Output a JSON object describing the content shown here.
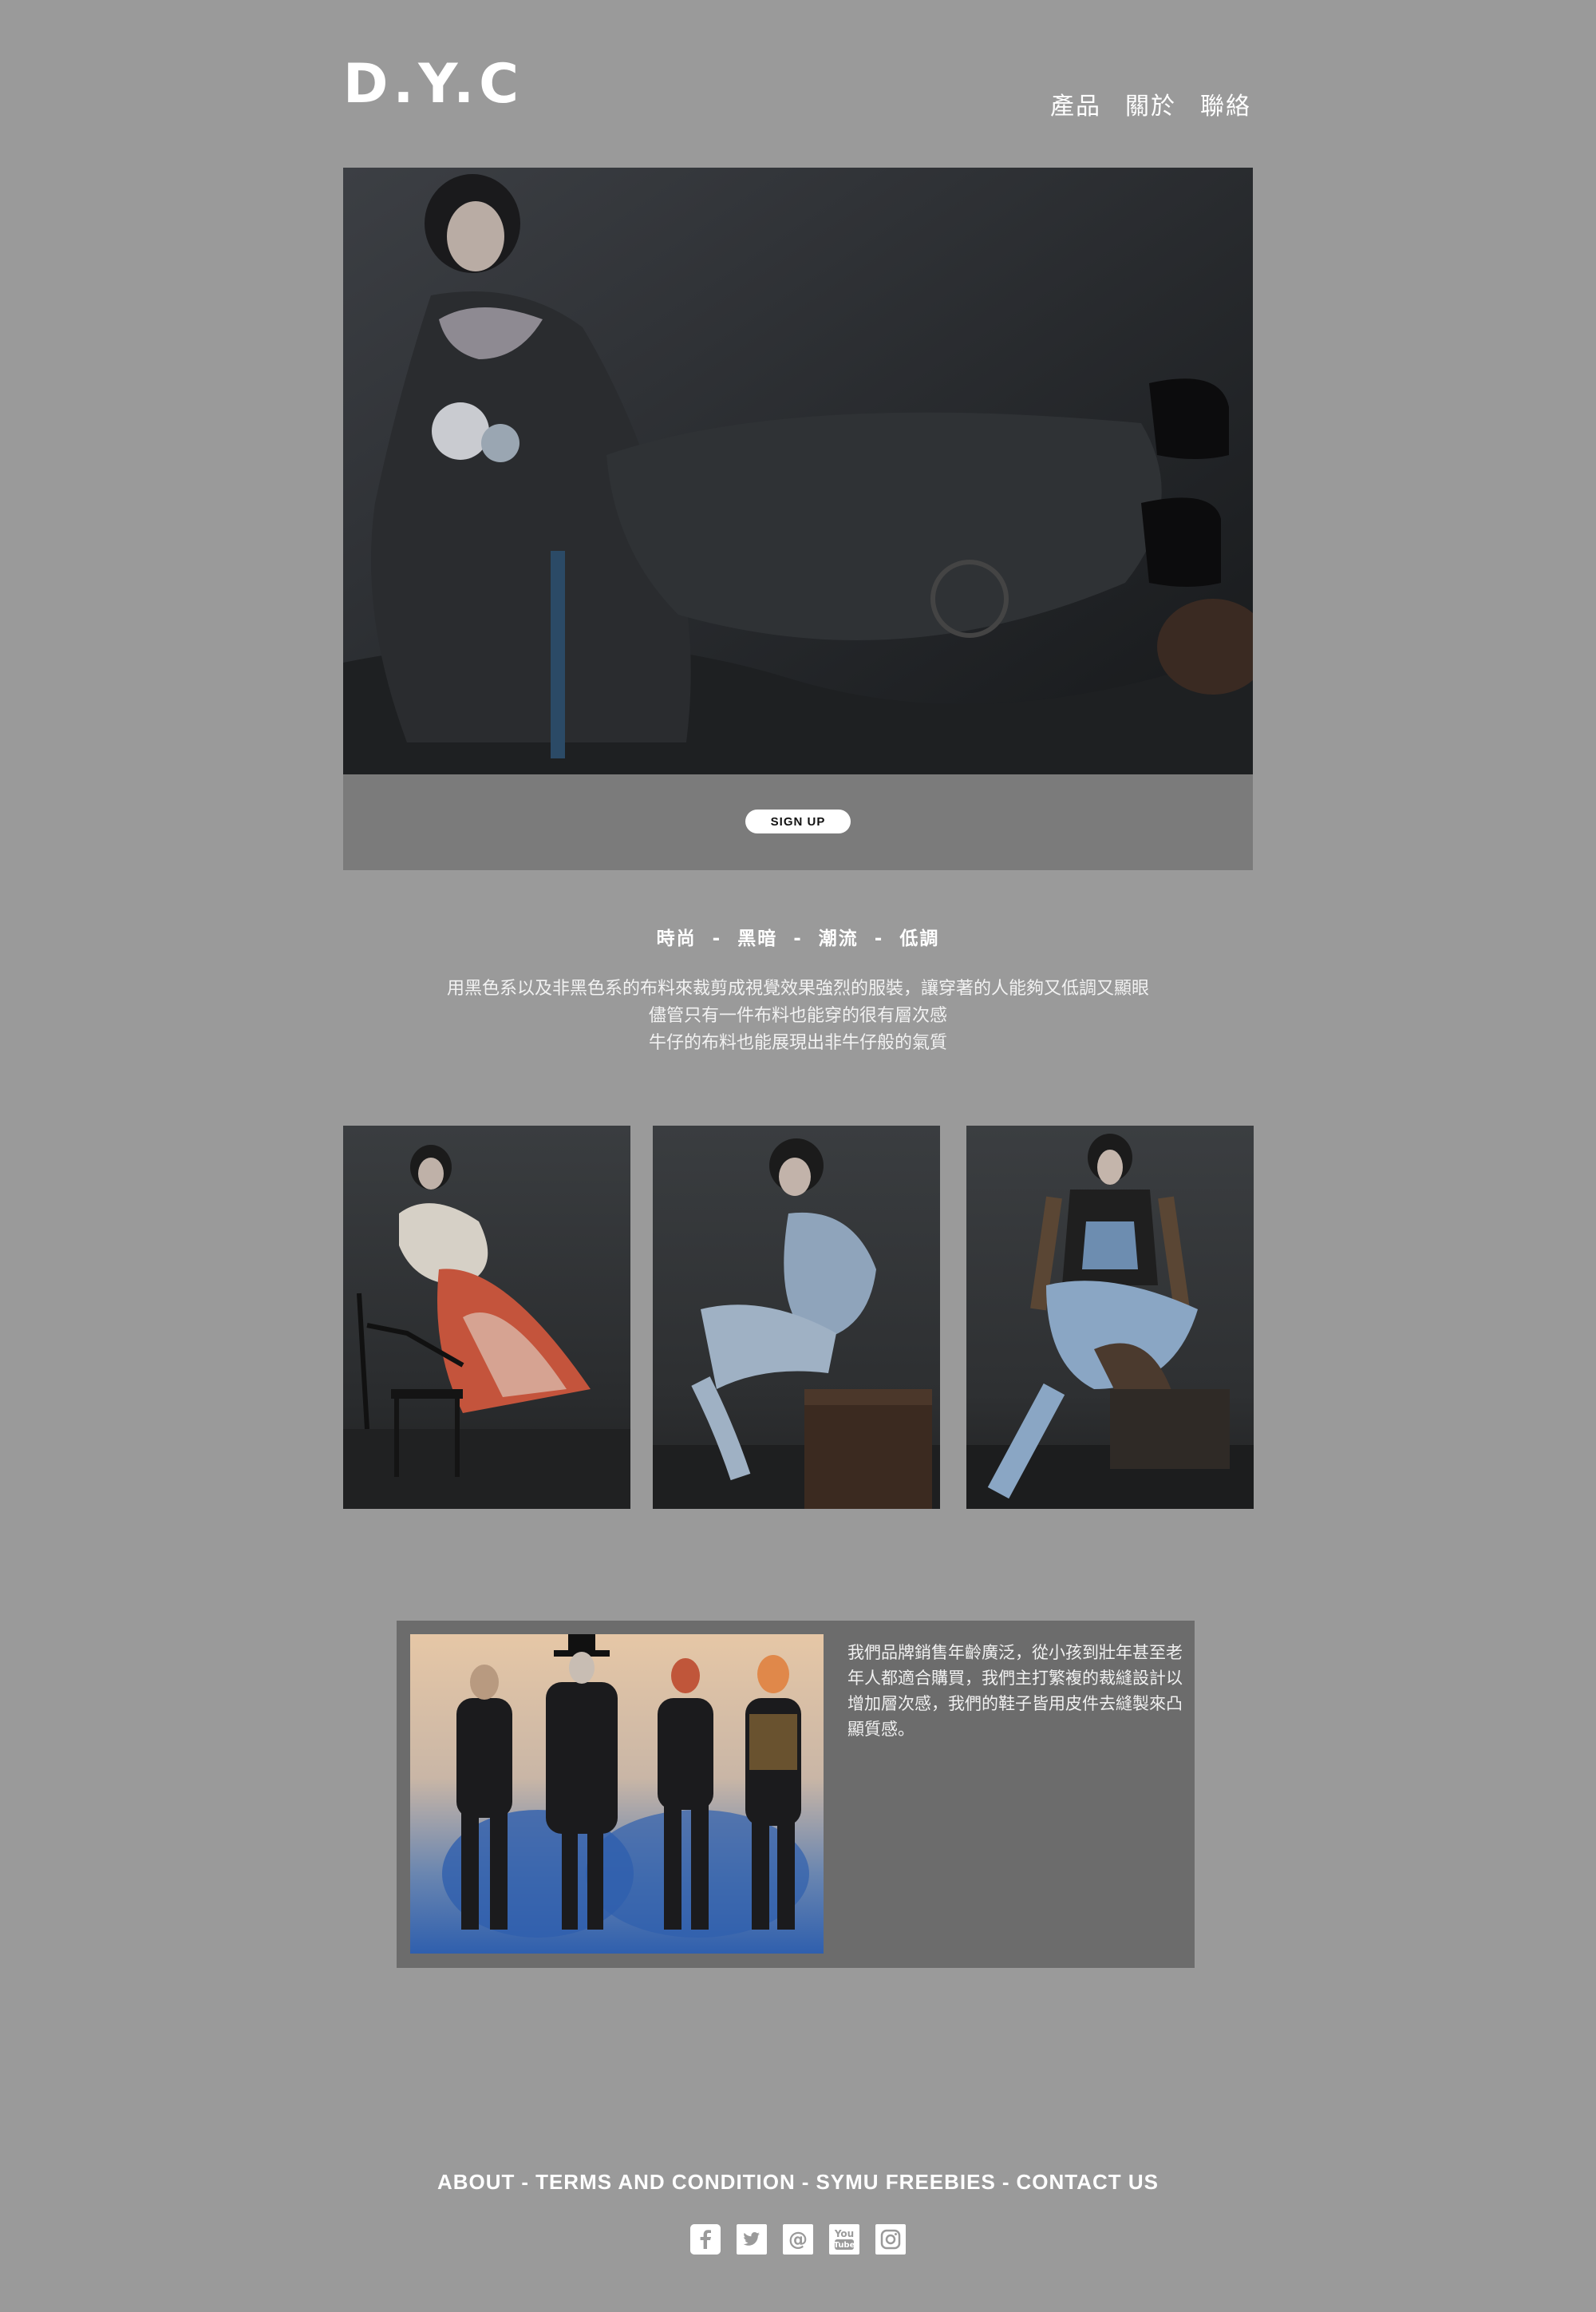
{
  "header": {
    "logo": "D.Y.C",
    "nav": [
      "產品",
      "關於",
      "聯絡"
    ]
  },
  "hero": {
    "signup_label": "SIGN UP"
  },
  "tagline": "時尚  -  黑暗  -  潮流  -  低調",
  "description": [
    "用黑色系以及非黑色系的布料來裁剪成視覺效果強烈的服裝，讓穿著的人能夠又低調又顯眼",
    "儘管只有一件布料也能穿的很有層次感",
    "牛仔的布料也能展現出非牛仔般的氣質"
  ],
  "feature": {
    "text": "我們品牌銷售年齡廣泛，從小孩到壯年甚至老年人都適合購買，我們主打繁複的裁縫設計以增加層次感，我們的鞋子皆用皮件去縫製來凸顯質感。"
  },
  "footer": {
    "links": [
      "ABOUT",
      "TERMS AND CONDITION",
      "SYMU FREEBIES",
      "CONTACT US"
    ],
    "separator": "-",
    "social_icons": [
      "facebook-icon",
      "twitter-icon",
      "email-icon",
      "youtube-icon",
      "instagram-icon"
    ]
  },
  "colors": {
    "page_background": "#9a9a9a",
    "panel": "#7b7b7b",
    "feature_panel": "#6c6c6c",
    "text": "#ffffff"
  }
}
